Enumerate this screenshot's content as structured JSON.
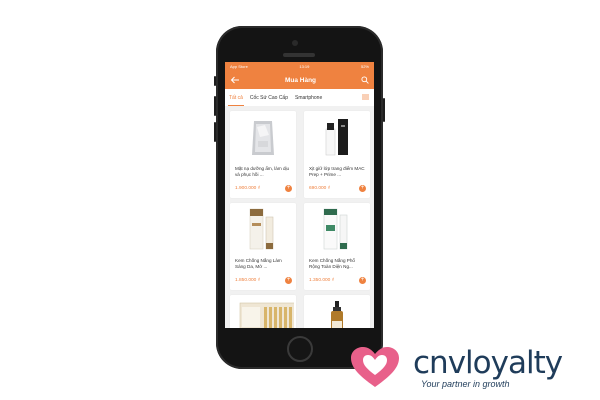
{
  "status_bar": {
    "carrier": "App Store",
    "time": "13:19",
    "battery": "52%"
  },
  "header": {
    "title": "Mua Hàng",
    "back_icon": "back-arrow-icon",
    "search_icon": "search-icon"
  },
  "tabs": [
    {
      "label": "Tất cả",
      "active": true
    },
    {
      "label": "Cốc Sứ Cao Cấp",
      "active": false
    },
    {
      "label": "Smartphone",
      "active": false
    }
  ],
  "products": [
    {
      "name": "Mặt nạ dưỡng ẩm, làm dịu và phục hồi ...",
      "price": "1.900.000 ₫"
    },
    {
      "name": "Xịt giữ lớp trang điểm MAC Prep + Prime ...",
      "price": "690.000 ₫"
    },
    {
      "name": "Kem Chống Nắng Làm Sáng Da, Mờ ...",
      "price": "1.850.000 ₫"
    },
    {
      "name": "Kem Chống Nắng Phổ Rộng Toàn Diện Ng...",
      "price": "1.350.000 ₫"
    },
    {
      "name": "",
      "price": ""
    },
    {
      "name": "",
      "price": ""
    }
  ],
  "colors": {
    "accent": "#ef8240",
    "logo_text": "#1f3c5a",
    "logo_heart": "#e8608a"
  },
  "logo": {
    "wordmark": "cnvloyalty",
    "tagline": "Your partner in growth"
  }
}
